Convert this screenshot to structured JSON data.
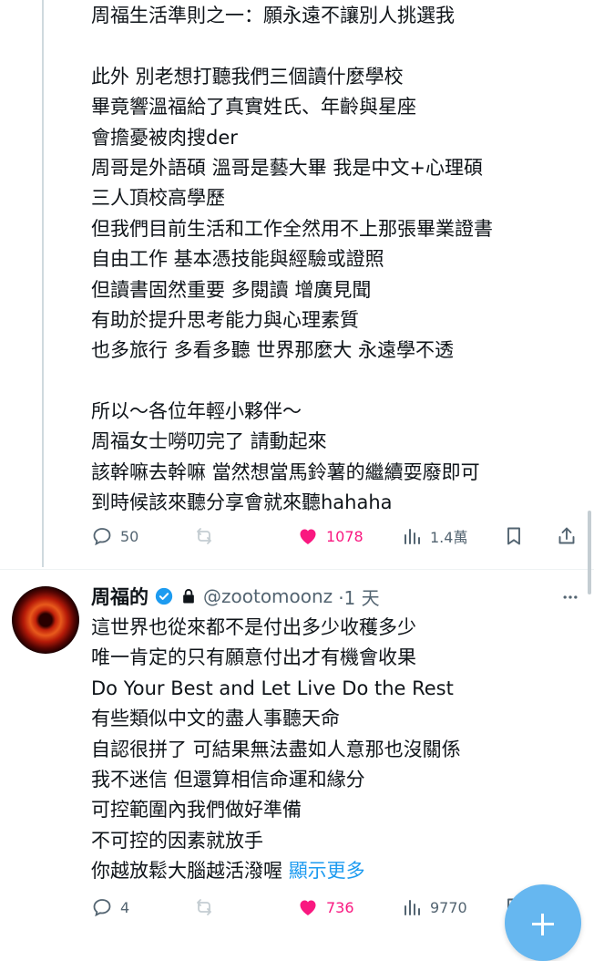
{
  "tweet1": {
    "lines": [
      "周福生活準則之一：願永遠不讓別人挑選我",
      "",
      "此外 別老想打聽我們三個讀什麼學校",
      "畢竟響溫福給了真實姓氏、年齡與星座",
      "會擔憂被肉搜der",
      "周哥是外語碩 溫哥是藝大畢 我是中文+心理碩",
      "三人頂校高學歷",
      "但我們目前生活和工作全然用不上那張畢業證書",
      "自由工作 基本憑技能與經驗或證照",
      "但讀書固然重要 多閱讀 增廣見聞",
      "有助於提升思考能力與心理素質",
      "也多旅行 多看多聽 世界那麼大 永遠學不透",
      "",
      "所以～各位年輕小夥伴～",
      "周福女士嘮叨完了 請動起來",
      "該幹嘛去幹嘛 當然想當馬鈴薯的繼續耍廢即可",
      "到時候該來聽分享會就來聽hahaha"
    ],
    "replies": "50",
    "likes": "1078",
    "views": "1.4萬"
  },
  "tweet2": {
    "name": "周福的",
    "handle": "@zootomoonz",
    "time": "·1 天",
    "lines": [
      "這世界也從來都不是付出多少收穫多少",
      "唯一肯定的只有願意付出才有機會收果",
      "Do Your Best and Let Live Do the Rest",
      "有些類似中文的盡人事聽天命",
      "自認很拼了 可結果無法盡如人意那也沒關係",
      "我不迷信 但還算相信命運和緣分",
      "可控範圍內我們做好準備",
      "不可控的因素就放手"
    ],
    "last_line": "你越放鬆大腦越活潑喔",
    "show_more": "顯示更多",
    "replies": "4",
    "likes": "736",
    "views": "9770"
  },
  "colors": {
    "text": "#0f1419",
    "muted": "#536471",
    "like": "#f91880",
    "link": "#1d9bf0",
    "verified": "#1d9bf0"
  }
}
